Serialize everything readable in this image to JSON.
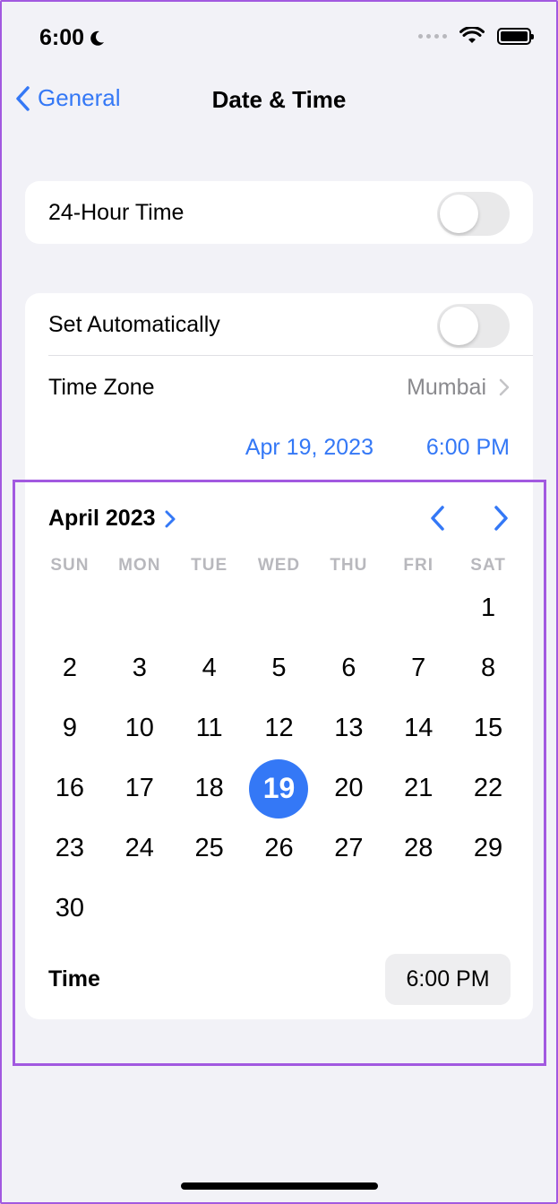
{
  "status_bar": {
    "time": "6:00"
  },
  "nav": {
    "back_label": "General",
    "title": "Date & Time"
  },
  "settings": {
    "hour24_label": "24-Hour Time",
    "hour24_on": false,
    "set_auto_label": "Set Automatically",
    "set_auto_on": false,
    "time_zone_label": "Time Zone",
    "time_zone_value": "Mumbai",
    "current_date": "Apr 19, 2023",
    "current_time": "6:00 PM"
  },
  "calendar": {
    "month_label": "April 2023",
    "weekdays": [
      "SUN",
      "MON",
      "TUE",
      "WED",
      "THU",
      "FRI",
      "SAT"
    ],
    "first_weekday_index": 6,
    "days_in_month": 30,
    "selected_day": 19,
    "selected_color": "#3478f6",
    "time_label": "Time",
    "time_value": "6:00 PM"
  },
  "colors": {
    "accent": "#3478f6",
    "highlight_border": "#a259e0"
  }
}
